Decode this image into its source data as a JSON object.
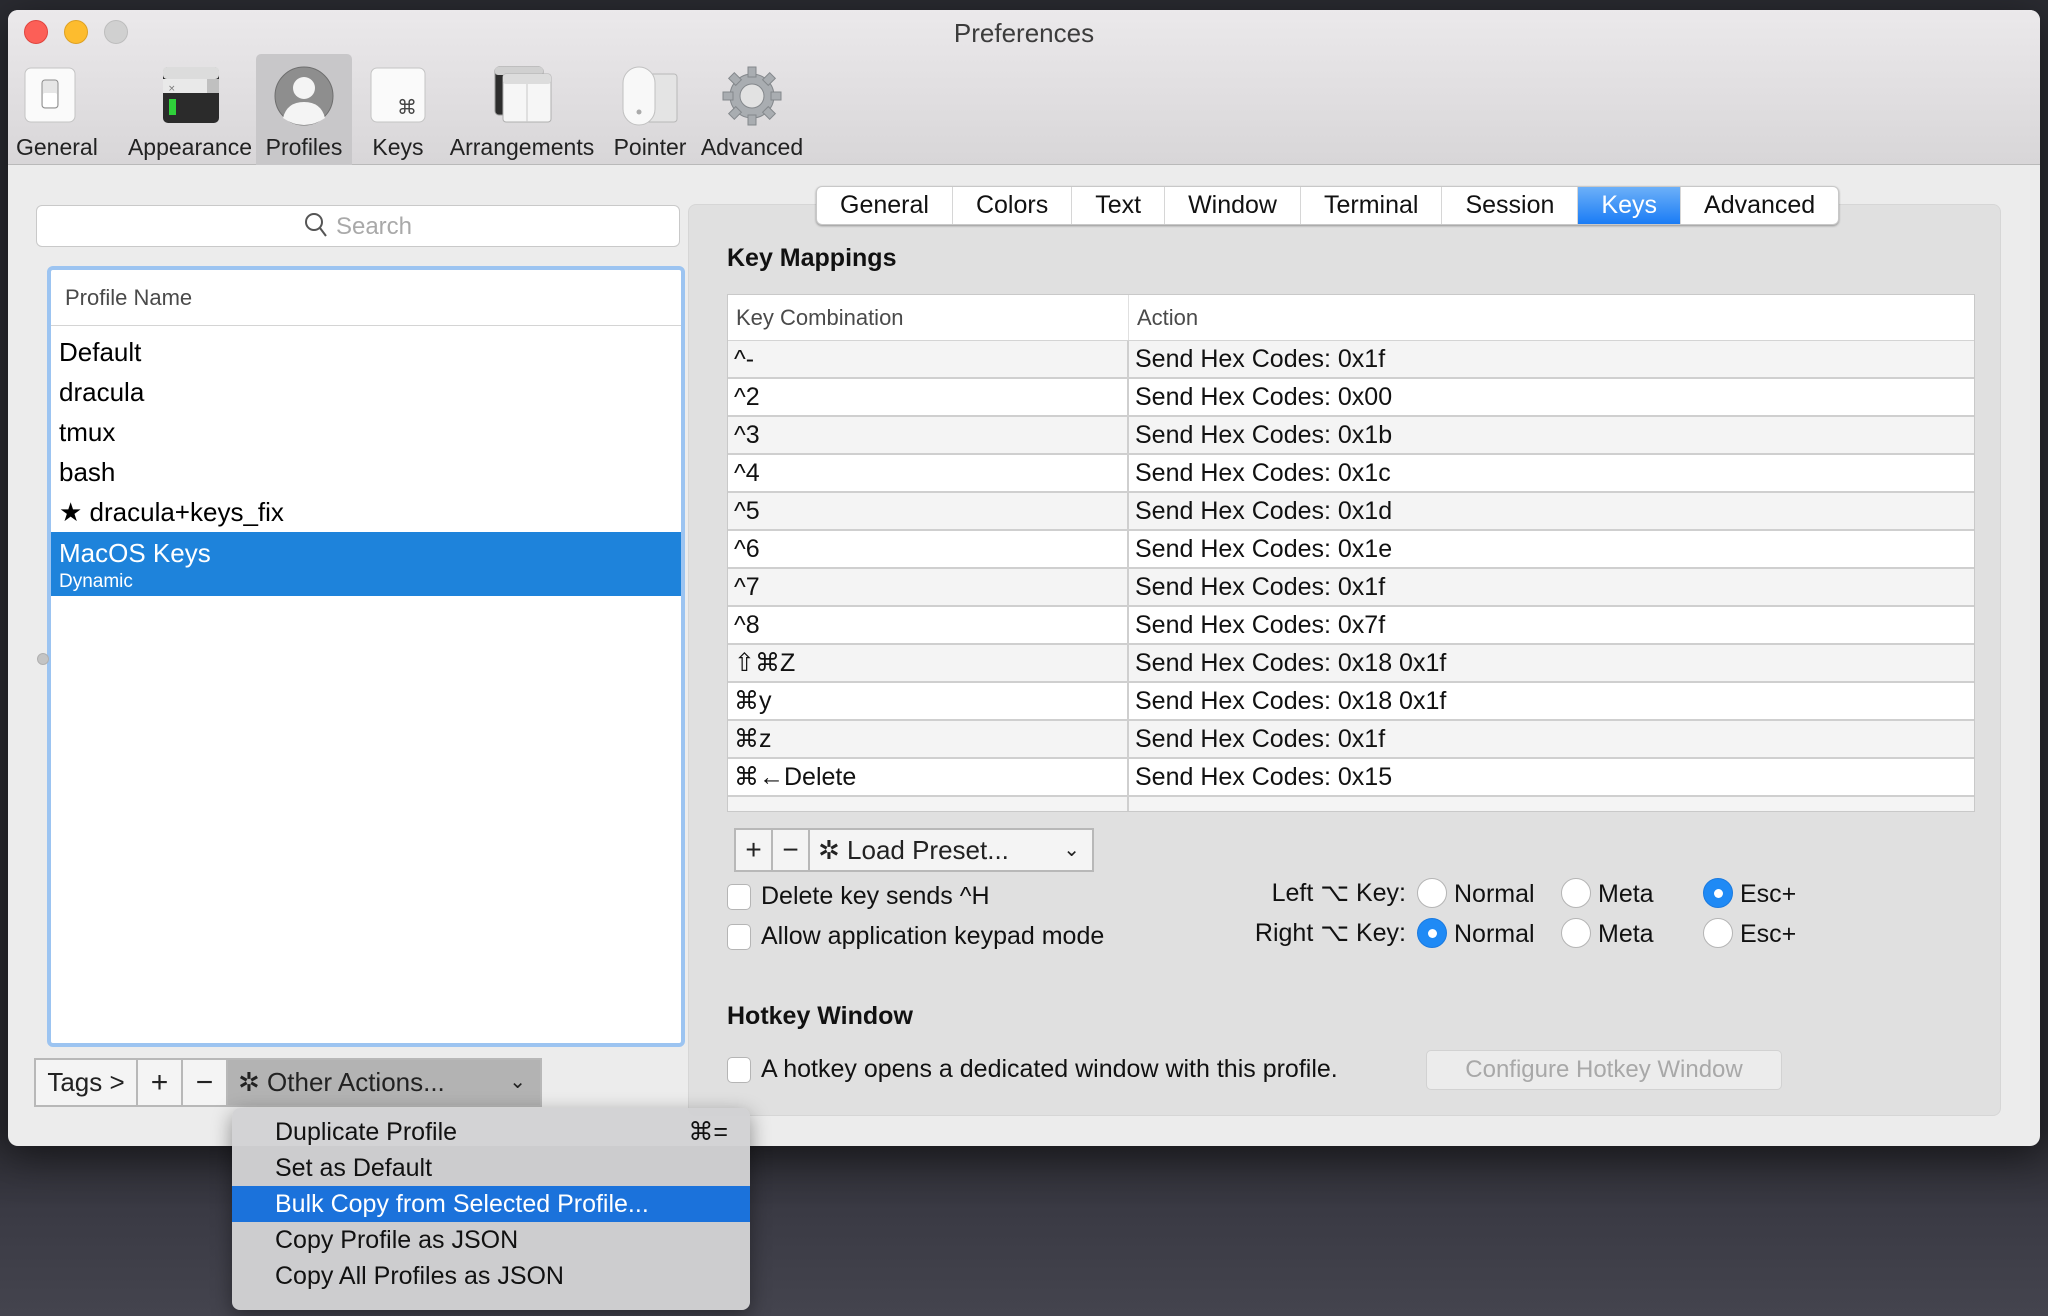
{
  "window": {
    "title": "Preferences"
  },
  "toolbar": {
    "items": [
      {
        "label": "General",
        "icon": "switch-icon",
        "active": false
      },
      {
        "label": "Appearance",
        "icon": "terminal-window-icon",
        "active": false
      },
      {
        "label": "Profiles",
        "icon": "user-silhouette-icon",
        "active": true
      },
      {
        "label": "Keys",
        "icon": "command-key-icon",
        "active": false
      },
      {
        "label": "Arrangements",
        "icon": "windows-icon",
        "active": false
      },
      {
        "label": "Pointer",
        "icon": "mouse-icon",
        "active": false
      },
      {
        "label": "Advanced",
        "icon": "gear-icon",
        "active": false
      }
    ]
  },
  "profiles": {
    "search_placeholder": "Search",
    "column_header": "Profile Name",
    "items": [
      {
        "name": "Default"
      },
      {
        "name": "dracula"
      },
      {
        "name": "tmux"
      },
      {
        "name": "bash"
      },
      {
        "name": "★ dracula+keys_fix"
      },
      {
        "name": "MacOS Keys",
        "subtitle": "Dynamic",
        "selected": true
      }
    ],
    "bottom_bar": {
      "tags_label": "Tags >",
      "add_label": "+",
      "remove_label": "−",
      "other_actions_label": "Other Actions..."
    }
  },
  "tabs": {
    "items": [
      "General",
      "Colors",
      "Text",
      "Window",
      "Terminal",
      "Session",
      "Keys",
      "Advanced"
    ],
    "active": "Keys"
  },
  "key_mappings": {
    "title": "Key Mappings",
    "columns": [
      "Key Combination",
      "Action"
    ],
    "rows": [
      {
        "key": "^-",
        "action": "Send Hex Codes: 0x1f"
      },
      {
        "key": "^2",
        "action": "Send Hex Codes: 0x00"
      },
      {
        "key": "^3",
        "action": "Send Hex Codes: 0x1b"
      },
      {
        "key": "^4",
        "action": "Send Hex Codes: 0x1c"
      },
      {
        "key": "^5",
        "action": "Send Hex Codes: 0x1d"
      },
      {
        "key": "^6",
        "action": "Send Hex Codes: 0x1e"
      },
      {
        "key": "^7",
        "action": "Send Hex Codes: 0x1f"
      },
      {
        "key": "^8",
        "action": "Send Hex Codes: 0x7f"
      },
      {
        "key": "⇧⌘Z",
        "action": "Send Hex Codes: 0x18 0x1f"
      },
      {
        "key": "⌘y",
        "action": "Send Hex Codes: 0x18 0x1f"
      },
      {
        "key": "⌘z",
        "action": "Send Hex Codes: 0x1f"
      },
      {
        "key": "⌘←Delete",
        "action": "Send Hex Codes: 0x15"
      }
    ],
    "controls": {
      "add_label": "+",
      "remove_label": "−",
      "load_preset_label": "Load Preset..."
    },
    "options": {
      "delete_sends_h": {
        "label": "Delete key sends ^H",
        "checked": false
      },
      "app_keypad": {
        "label": "Allow application keypad mode",
        "checked": false
      }
    },
    "option_keys": {
      "left_label": "Left ⌥ Key:",
      "right_label": "Right ⌥ Key:",
      "choices": [
        "Normal",
        "Meta",
        "Esc+"
      ],
      "left_selected": "Esc+",
      "right_selected": "Normal"
    }
  },
  "hotkey": {
    "title": "Hotkey Window",
    "checkbox_label": "A hotkey opens a dedicated window with this profile.",
    "checked": false,
    "configure_button": "Configure Hotkey Window"
  },
  "other_actions_menu": {
    "items": [
      {
        "label": "Duplicate Profile",
        "shortcut": "⌘="
      },
      {
        "label": "Set as Default"
      },
      {
        "label": "Bulk Copy from Selected Profile...",
        "highlighted": true
      },
      {
        "label": "Copy Profile as JSON"
      },
      {
        "label": "Copy All Profiles as JSON"
      }
    ]
  },
  "colors": {
    "accent": "#1e83db",
    "tab_active": "#1a7cf5",
    "menu_highlight": "#1b72db",
    "focus_ring": "#9cc4f1"
  }
}
